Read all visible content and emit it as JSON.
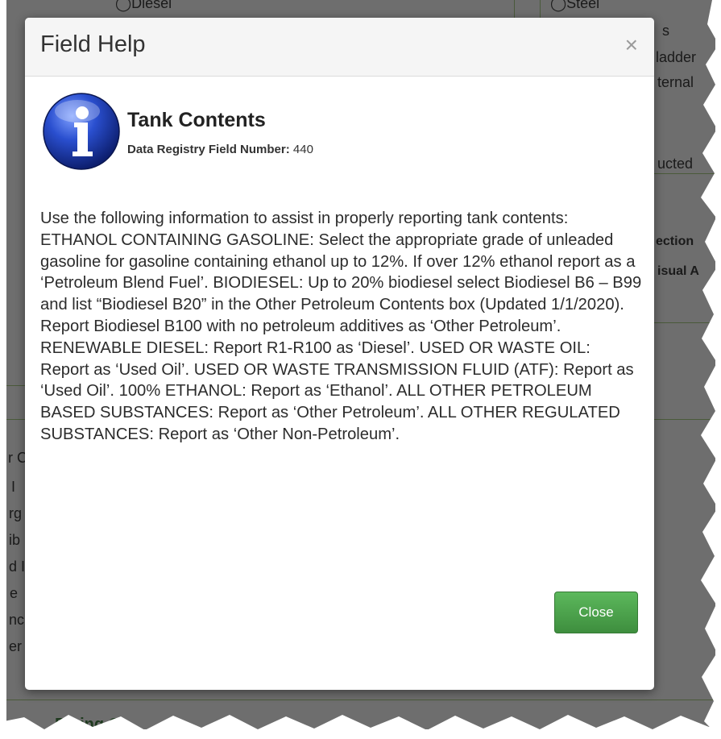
{
  "background": {
    "fragments": [
      "◯Diesel",
      "◯Steel",
      "s",
      "ladder",
      "ternal",
      "ucted",
      "ection",
      "isual A",
      "r C",
      "I",
      "rg",
      "ib",
      "d I",
      "e",
      "nc",
      "er"
    ],
    "link_text": "Piping Co"
  },
  "modal": {
    "title": "Field Help",
    "close_symbol": "×",
    "field_name": "Tank Contents",
    "registry_label": "Data Registry Field Number:",
    "registry_number": "440",
    "help_text": "Use the following information to assist in properly reporting tank contents: ETHANOL CONTAINING GASOLINE: Select the appropriate grade of unleaded gasoline for gasoline containing ethanol up to 12%. If over 12% ethanol report as a ‘Petroleum Blend Fuel’. BIODIESEL: Up to 20% biodiesel select Biodiesel B6 – B99 and list “Biodiesel B20” in the Other Petroleum Contents box (Updated 1/1/2020). Report Biodiesel B100 with no petroleum additives as ‘Other Petroleum’. RENEWABLE DIESEL: Report R1-R100 as ‘Diesel’. USED OR WASTE OIL: Report as ‘Used Oil’. USED OR WASTE TRANSMISSION FLUID (ATF): Report as ‘Used Oil’. 100% ETHANOL: Report as ‘Ethanol’. ALL OTHER PETROLEUM BASED SUBSTANCES: Report as ‘Other Petroleum’. ALL OTHER REGULATED SUBSTANCES: Report as ‘Other Non-Petroleum’.",
    "close_button_label": "Close",
    "icon": "info-icon",
    "accent_color": "#4cae4c",
    "icon_color": "#1c3a9e"
  }
}
